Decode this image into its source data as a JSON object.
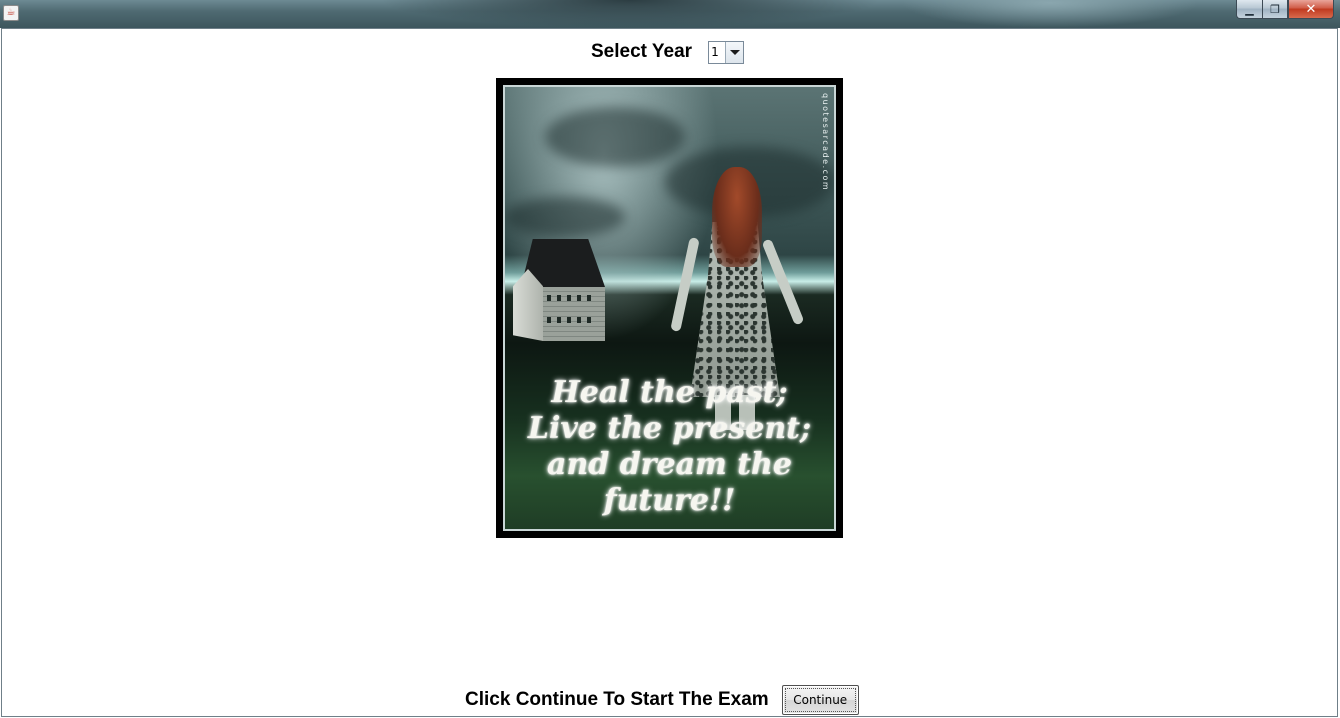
{
  "window": {
    "app_icon": "java-cup-icon",
    "controls": {
      "minimize_icon": "minimize-icon",
      "maximize_icon": "maximize-icon",
      "close_icon": "close-icon",
      "minimize_glyph": "▁",
      "maximize_glyph": "❐",
      "close_glyph": "✕"
    }
  },
  "year_selector": {
    "label": "Select Year",
    "selected_value": "1"
  },
  "poster": {
    "watermark": "quotesarcade.com",
    "quote_lines": [
      "Heal the past;",
      "Live the present;",
      "and dream the future!!"
    ]
  },
  "footer": {
    "prompt": "Click Continue To Start The Exam",
    "continue_label": "Continue"
  }
}
